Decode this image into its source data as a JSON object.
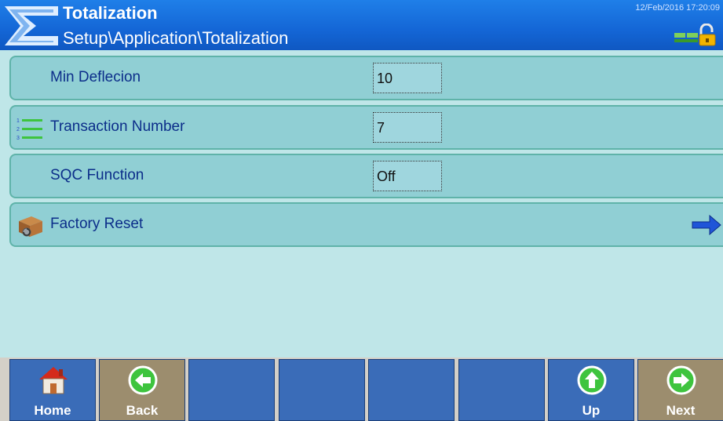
{
  "header": {
    "title": "Totalization",
    "path": "Setup\\Application\\Totalization",
    "datetime": "12/Feb/2016 17:20:09"
  },
  "rows": [
    {
      "label": "Min Deflecion",
      "value": "10",
      "icon": "none"
    },
    {
      "label": "Transaction Number",
      "value": "7",
      "icon": "numbered-list-icon"
    },
    {
      "label": "SQC Function",
      "value": "Off",
      "icon": "none"
    },
    {
      "label": "Factory Reset",
      "icon": "reset-box-icon",
      "action": "right-arrow-icon"
    }
  ],
  "softkeys": [
    {
      "label": "Home",
      "icon": "home-icon"
    },
    {
      "label": "Back",
      "icon": "back-arrow-icon"
    },
    {
      "label": "",
      "icon": "none"
    },
    {
      "label": "",
      "icon": "none"
    },
    {
      "label": "",
      "icon": "none"
    },
    {
      "label": "",
      "icon": "none"
    },
    {
      "label": "Up",
      "icon": "up-arrow-icon"
    },
    {
      "label": "Next",
      "icon": "next-arrow-icon"
    }
  ],
  "colors": {
    "header": "#1466d6",
    "row": "#90cfd4",
    "row_text": "#0c2e8a",
    "softkey_blue": "#3a6cb8",
    "softkey_tan": "#9c8d6e"
  }
}
